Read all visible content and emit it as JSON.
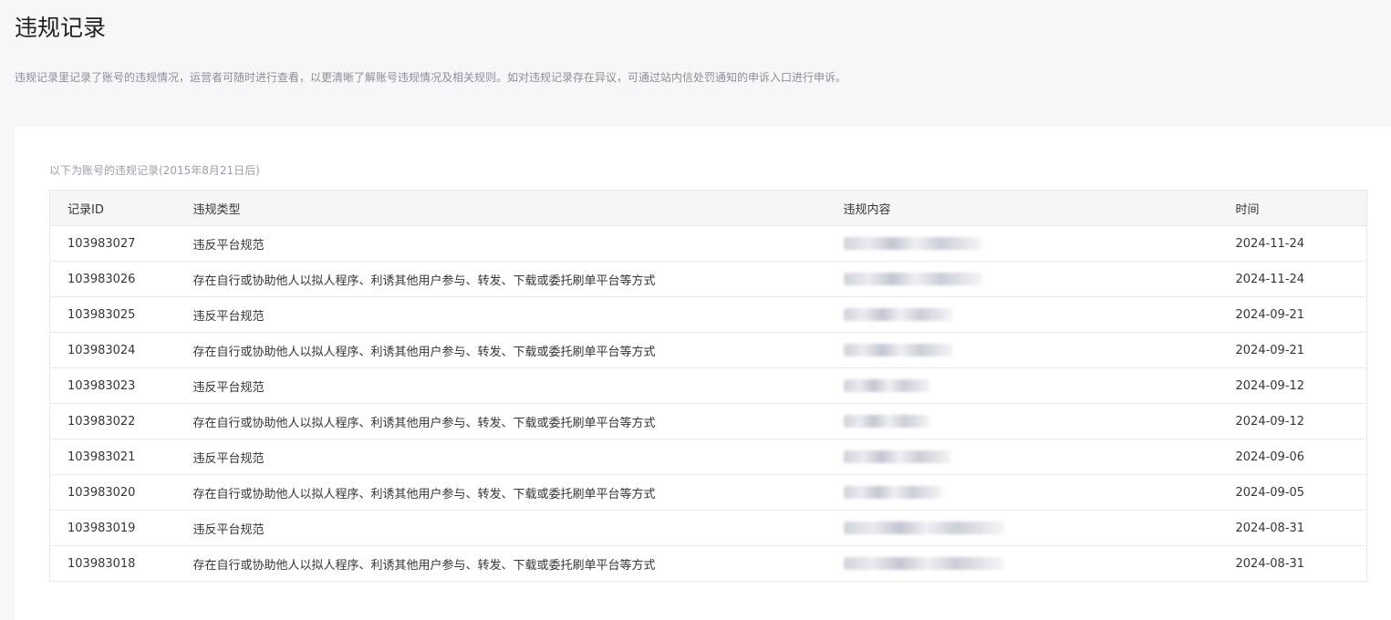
{
  "page": {
    "title": "违规记录",
    "description": "违规记录里记录了账号的违规情况，运营者可随时进行查看，以更清晰了解账号违规情况及相关规则。如对违规记录存在异议，可通过站内信处罚通知的申诉入口进行申诉。"
  },
  "table": {
    "caption": "以下为账号的违规记录(2015年8月21日后)",
    "headers": {
      "id": "记录ID",
      "type": "违规类型",
      "content": "违规内容",
      "time": "时间"
    },
    "rows": [
      {
        "id": "103983027",
        "type": "违反平台规范",
        "time": "2024-11-24"
      },
      {
        "id": "103983026",
        "type": "存在自行或协助他人以拟人程序、利诱其他用户参与、转发、下载或委托刷单平台等方式",
        "time": "2024-11-24"
      },
      {
        "id": "103983025",
        "type": "违反平台规范",
        "time": "2024-09-21"
      },
      {
        "id": "103983024",
        "type": "存在自行或协助他人以拟人程序、利诱其他用户参与、转发、下载或委托刷单平台等方式",
        "time": "2024-09-21"
      },
      {
        "id": "103983023",
        "type": "违反平台规范",
        "time": "2024-09-12"
      },
      {
        "id": "103983022",
        "type": "存在自行或协助他人以拟人程序、利诱其他用户参与、转发、下载或委托刷单平台等方式",
        "time": "2024-09-12"
      },
      {
        "id": "103983021",
        "type": "违反平台规范",
        "time": "2024-09-06"
      },
      {
        "id": "103983020",
        "type": "存在自行或协助他人以拟人程序、利诱其他用户参与、转发、下载或委托刷单平台等方式",
        "time": "2024-09-05"
      },
      {
        "id": "103983019",
        "type": "违反平台规范",
        "time": "2024-08-31"
      },
      {
        "id": "103983018",
        "type": "存在自行或协助他人以拟人程序、利诱其他用户参与、转发、下载或委托刷单平台等方式",
        "time": "2024-08-31"
      }
    ]
  }
}
